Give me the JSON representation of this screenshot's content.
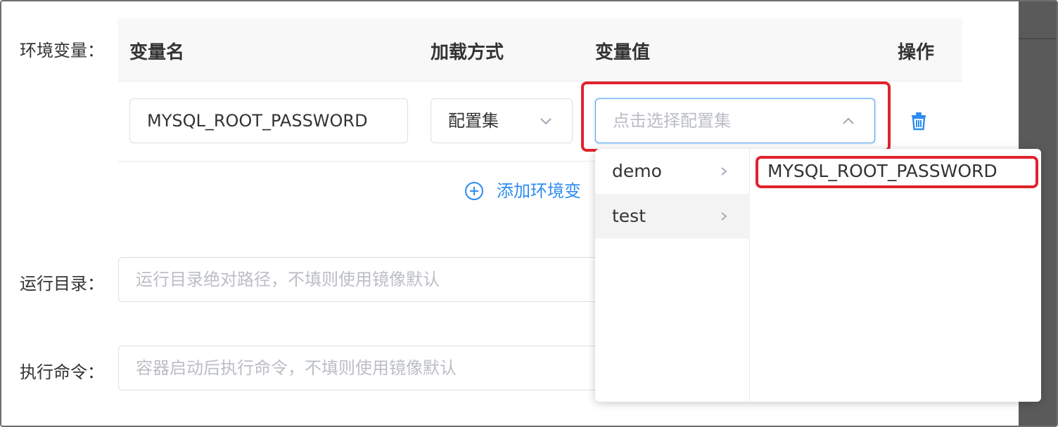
{
  "form": {
    "env_label": "环境变量：",
    "workdir_label": "运行目录：",
    "command_label": "执行命令："
  },
  "env_table": {
    "headers": {
      "name": "变量名",
      "load_mode": "加载方式",
      "value": "变量值",
      "action": "操作"
    },
    "row": {
      "name_value": "MYSQL_ROOT_PASSWORD",
      "load_mode_selected": "配置集",
      "value_placeholder": "点击选择配置集"
    },
    "add_label": "添加环境变"
  },
  "workdir": {
    "placeholder": "运行目录绝对路径，不填则使用镜像默认"
  },
  "command": {
    "placeholder": "容器启动后执行命令，不填则使用镜像默认"
  },
  "cascader": {
    "level1": [
      {
        "label": "demo",
        "active": false
      },
      {
        "label": "test",
        "active": true
      }
    ],
    "level2": [
      {
        "label": "MYSQL_ROOT_PASSWORD"
      }
    ]
  },
  "icons": {
    "chevron_down": "chevron-down-icon",
    "chevron_up": "chevron-up-icon",
    "delete": "trash-icon",
    "add": "plus-circle-icon",
    "submenu": "chevron-right-icon"
  },
  "colors": {
    "primary": "#2d8cf0",
    "highlight_box": "#e0232d",
    "placeholder": "#bbbec4"
  }
}
